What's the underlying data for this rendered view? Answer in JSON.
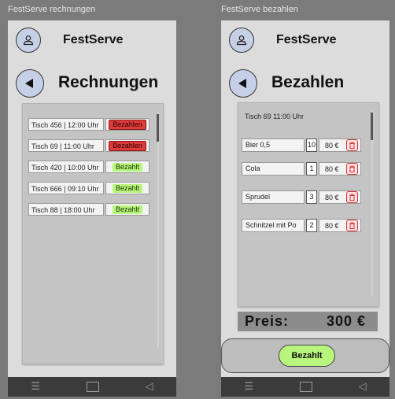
{
  "frames": {
    "left_title": "FestServe rechnungen",
    "right_title": "FestServe bezahlen"
  },
  "app": {
    "brand": "FestServe"
  },
  "rechnungen": {
    "title": "Rechnungen",
    "orders": [
      {
        "table": "Tisch 456 | 12:00 Uhr",
        "status": "Bezahlen",
        "paid": false
      },
      {
        "table": "Tisch 69 | 11:00 Uhr",
        "status": "Bezahlen",
        "paid": false
      },
      {
        "table": "Tisch 420 | 10:00 Uhr",
        "status": "Bezahlt",
        "paid": true
      },
      {
        "table": "Tisch 666 | 09:10 Uhr",
        "status": "Bezahlt",
        "paid": true
      },
      {
        "table": "Tisch 88 | 18:00 Uhr",
        "status": "Bezahlt",
        "paid": true
      }
    ]
  },
  "bezahlen": {
    "title": "Bezahlen",
    "table_info": "Tisch 69 11:00 Uhr",
    "items": [
      {
        "name": "Bier 0,5",
        "qty": "10",
        "price": "80 €"
      },
      {
        "name": "Cola",
        "qty": "1",
        "price": "80 €"
      },
      {
        "name": "Sprudel",
        "qty": "3",
        "price": "80 €"
      },
      {
        "name": "Schnitzel mit Po",
        "qty": "2",
        "price": "80 €"
      }
    ],
    "price_label": "Preis:",
    "price_value": "300 €",
    "pay_button": "Bezahlt"
  },
  "navbar": {
    "menu_glyph": "☰",
    "back_glyph": "◁"
  },
  "colors": {
    "accent_blue": "#c5d0e6",
    "unpaid_red": "#de3b3b",
    "paid_green": "#b8f57c"
  }
}
